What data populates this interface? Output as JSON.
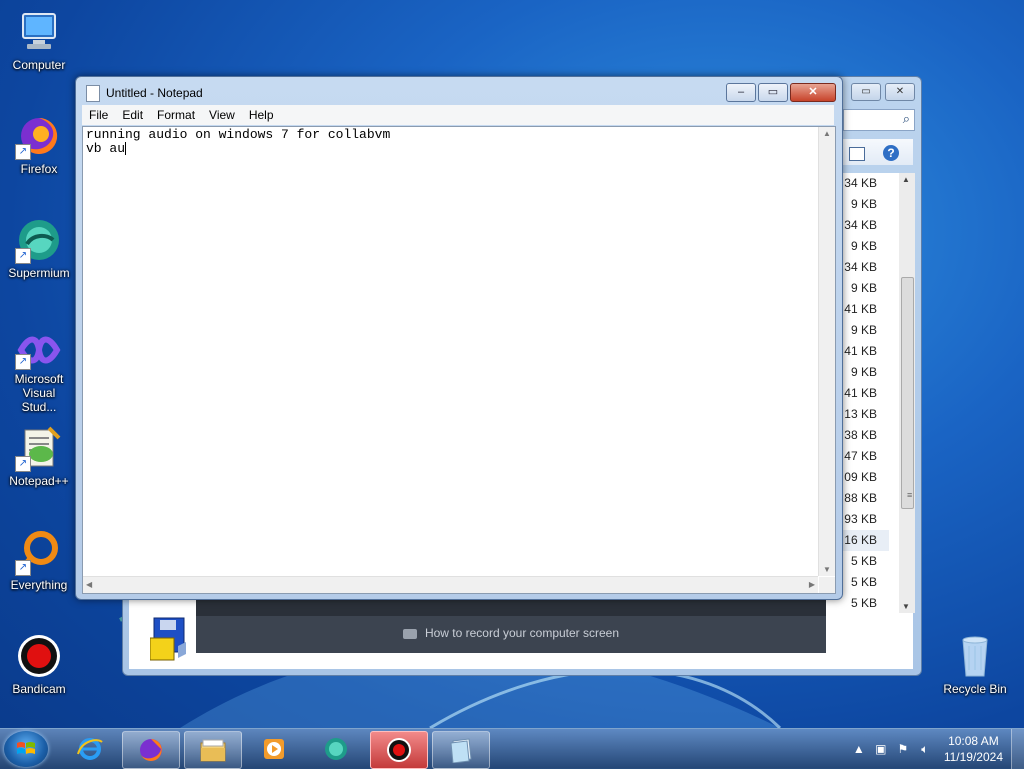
{
  "desktop": {
    "icons": [
      {
        "label": "Computer",
        "icon": "computer-icon"
      },
      {
        "label": "Firefox",
        "icon": "firefox-icon"
      },
      {
        "label": "Supermium",
        "icon": "supermium-icon"
      },
      {
        "label": "Microsoft Visual Stud...",
        "icon": "visual-studio-icon"
      },
      {
        "label": "Notepad++",
        "icon": "notepadpp-icon"
      },
      {
        "label": "Everything",
        "icon": "everything-icon"
      },
      {
        "label": "Bandicam",
        "icon": "bandicam-icon"
      },
      {
        "label": "Recycle Bin",
        "icon": "recycle-bin-icon"
      }
    ]
  },
  "explorer": {
    "sizes": [
      "34 KB",
      "9 KB",
      "34 KB",
      "9 KB",
      "34 KB",
      "9 KB",
      "41 KB",
      "9 KB",
      "41 KB",
      "9 KB",
      "41 KB",
      "13 KB",
      "38 KB",
      "47 KB",
      "09 KB",
      "88 KB",
      "93 KB",
      "16 KB",
      "5 KB",
      "5 KB",
      "5 KB"
    ],
    "selected_index": 17
  },
  "banner": {
    "message": "How to record your computer screen"
  },
  "notepad": {
    "title": "Untitled - Notepad",
    "menu": [
      "File",
      "Edit",
      "Format",
      "View",
      "Help"
    ],
    "lines": [
      "running audio on windows 7 for collabvm",
      "vb au"
    ],
    "controls": {
      "minimize": "–",
      "maximize": "▭",
      "close": "✕"
    }
  },
  "taskbar": {
    "clock_time": "10:08 AM",
    "clock_date": "11/19/2024",
    "pinned": [
      {
        "icon": "internet-explorer-icon",
        "open": false
      },
      {
        "icon": "firefox-icon",
        "open": true
      },
      {
        "icon": "file-explorer-icon",
        "open": true
      },
      {
        "icon": "media-player-icon",
        "open": false
      },
      {
        "icon": "supermium-icon",
        "open": false
      },
      {
        "icon": "bandicam-icon",
        "open": true
      },
      {
        "icon": "notepad-icon",
        "open": true
      }
    ]
  },
  "colors": {
    "desktop_bg": "#1a64c4",
    "close_button": "#c7432a",
    "bandicam_red": "#e01010"
  }
}
